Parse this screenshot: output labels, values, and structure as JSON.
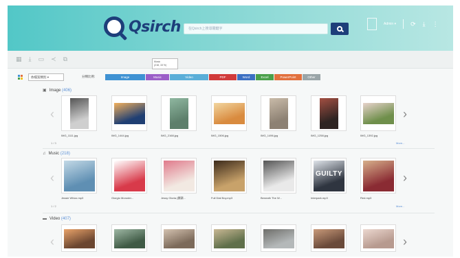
{
  "header": {
    "logo_text": "Qsirch",
    "search_placeholder": "在Qsirch上搜尋關鍵字",
    "user_name": "Admin ▾"
  },
  "tooltip": {
    "line1": "Music",
    "line2": "(218, 15 %)"
  },
  "filter": {
    "select_value": "依檔案類別",
    "sort_label": "分類比例:",
    "chips": [
      {
        "label": "Image",
        "color": "#3f92d3"
      },
      {
        "label": "Music",
        "color": "#9b5fc8"
      },
      {
        "label": "Video",
        "color": "#5aaed8"
      },
      {
        "label": "PDF",
        "color": "#d13a3a"
      },
      {
        "label": "Word",
        "color": "#3b6fc2"
      },
      {
        "label": "Excel",
        "color": "#4aa04a"
      },
      {
        "label": "PowerPoint",
        "color": "#e2703d"
      },
      {
        "label": "Other",
        "color": "#9aa5a8"
      }
    ]
  },
  "sections": {
    "image": {
      "title": "Image",
      "count": "(406)",
      "pager": "1 / 3",
      "more": "More...",
      "items": [
        {
          "caption": "IMG_1111.jpg",
          "color": "#cfcfcf",
          "accent": "#555555",
          "portrait": true
        },
        {
          "caption": "IMG_1444.jpg",
          "color": "#1f3f73",
          "accent": "#f2b05c",
          "portrait": false
        },
        {
          "caption": "IMG_2168.jpg",
          "color": "#5d7f6b",
          "accent": "#8fb7a0",
          "portrait": true
        },
        {
          "caption": "IMG_1506.jpg",
          "color": "#d98b3f",
          "accent": "#f2d6a0",
          "portrait": false
        },
        {
          "caption": "IMG_1496.jpg",
          "color": "#8d8173",
          "accent": "#c9bba9",
          "portrait": true
        },
        {
          "caption": "IMG_1258.jpg",
          "color": "#2e2422",
          "accent": "#a34f42",
          "portrait": true
        },
        {
          "caption": "IMG_1392.jpg",
          "color": "#6f8f4b",
          "accent": "#e8d3cc",
          "portrait": false
        }
      ]
    },
    "music": {
      "title": "Music",
      "count": "(218)",
      "pager": "1 / 2",
      "more": "More...",
      "items": [
        {
          "caption": "Jessie Whizz.mp3",
          "color": "#5f8fb3",
          "accent": "#c3d9e6",
          "label": ""
        },
        {
          "caption": "Giorgio Moroder...",
          "color": "#d83a4a",
          "accent": "#ffffff",
          "label": ""
        },
        {
          "caption": "Jessy Gloria (開頭...",
          "color": "#f2e9e2",
          "accent": "#e07a8b",
          "label": ""
        },
        {
          "caption": "Full Dial Boy.mp3",
          "color": "#c8a26a",
          "accent": "#3c2a1a",
          "label": ""
        },
        {
          "caption": "Beneath The W...",
          "color": "#e9e9e9",
          "accent": "#555555",
          "label": ""
        },
        {
          "caption": "Interpark.mp3",
          "color": "#2f3540",
          "accent": "#dfe4ea",
          "label": "GUILTY"
        },
        {
          "caption": "Red.mp3",
          "color": "#8a2b33",
          "accent": "#d7b08b",
          "label": ""
        }
      ]
    },
    "video": {
      "title": "Video",
      "count": "(407)",
      "items": [
        {
          "color": "#6b4630",
          "accent": "#e9a36a"
        },
        {
          "color": "#3f5a45",
          "accent": "#9fb8a5"
        },
        {
          "color": "#7c6a5a",
          "accent": "#d4c2b0"
        },
        {
          "color": "#5f6f4a",
          "accent": "#c9b894"
        },
        {
          "color": "#b4b8b9",
          "accent": "#6e6e6a"
        },
        {
          "color": "#6a4a3a",
          "accent": "#c99a7a"
        },
        {
          "color": "#b79a8f",
          "accent": "#ecd8d0"
        }
      ]
    }
  }
}
